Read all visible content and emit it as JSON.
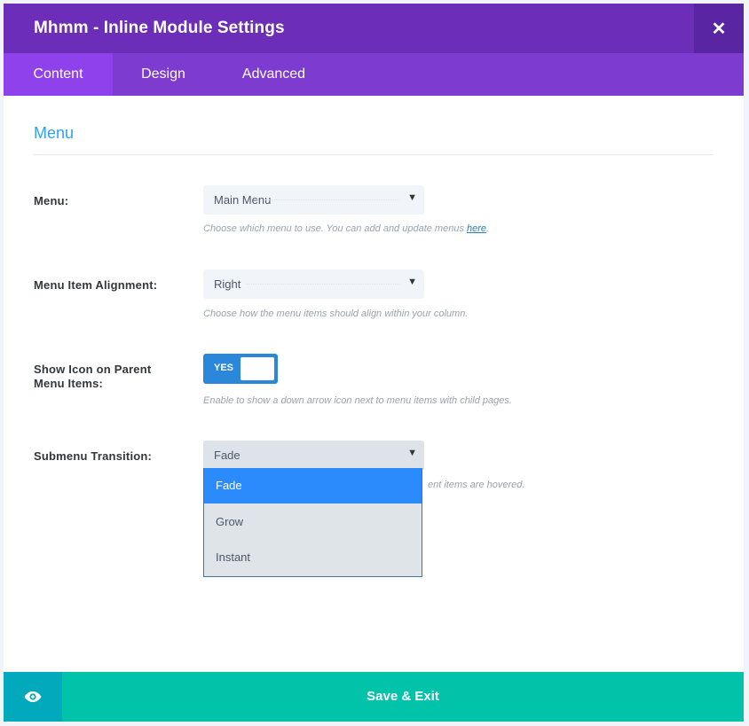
{
  "header": {
    "title": "Mhmm - Inline Module Settings",
    "close_symbol": "✕"
  },
  "tabs": [
    {
      "label": "Content",
      "active": true
    },
    {
      "label": "Design",
      "active": false
    },
    {
      "label": "Advanced",
      "active": false
    }
  ],
  "section": {
    "title": "Menu"
  },
  "fields": {
    "menu": {
      "label": "Menu:",
      "value": "Main Menu",
      "description_before": "Choose which menu to use. You can add and update menus ",
      "description_link": "here",
      "description_after": "."
    },
    "alignment": {
      "label": "Menu Item Alignment:",
      "value": "Right",
      "description": "Choose how the menu items should align within your column."
    },
    "show_icon": {
      "label": "Show Icon on Parent Menu Items:",
      "toggle_label": "YES",
      "enabled": true,
      "description": "Enable to show a down arrow icon next to menu items with child pages."
    },
    "submenu_transition": {
      "label": "Submenu Transition:",
      "value": "Fade",
      "description_visible": "ent items are hovered.",
      "options": [
        "Fade",
        "Grow",
        "Instant"
      ],
      "selected": "Fade"
    }
  },
  "footer": {
    "preview_icon": "eye-icon",
    "save_label": "Save & Exit"
  },
  "colors": {
    "titlebar": "#6c2eb9",
    "tabbar": "#7d3bcf",
    "tab_active": "#8f42ec",
    "accent_blue": "#2ea3f2",
    "toggle": "#2b87da",
    "footer": "#00c3aa",
    "preview": "#00a9bc"
  }
}
